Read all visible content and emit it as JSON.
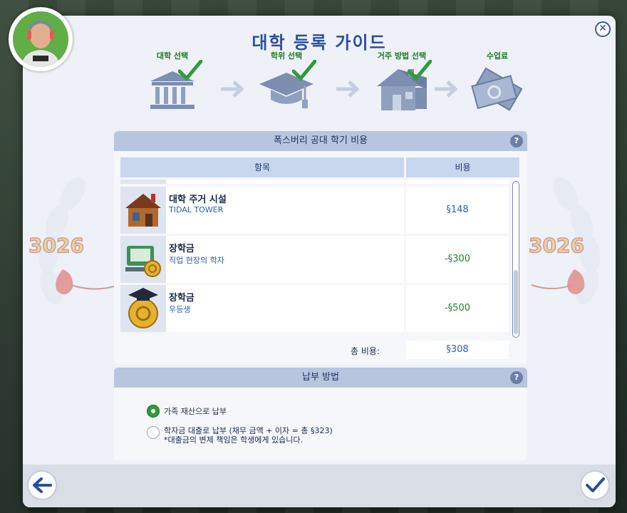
{
  "window": {
    "title": "대학 등록 가이드"
  },
  "steps": [
    {
      "label": "대학 선택",
      "done": true,
      "icon": "university-building-icon"
    },
    {
      "label": "학위 선택",
      "done": true,
      "icon": "graduation-cap-icon"
    },
    {
      "label": "거주 방법 선택",
      "done": true,
      "icon": "house-icon"
    },
    {
      "label": "수업료",
      "done": false,
      "icon": "money-bills-icon"
    }
  ],
  "cost_panel": {
    "title": "폭스버리 공대 학기 비용",
    "col_item": "항목",
    "col_cost": "비용",
    "rows": [
      {
        "name": "대학 주거 시설",
        "sub": "TIDAL TOWER",
        "cost": "§148",
        "cost_type": "charge",
        "icon": "house-icon"
      },
      {
        "name": "장학금",
        "sub": "직업 현장의 학자",
        "cost": "-§300",
        "cost_type": "credit",
        "icon": "computer-coin-icon"
      },
      {
        "name": "장학금",
        "sub": "우등생",
        "cost": "-§500",
        "cost_type": "credit",
        "icon": "gold-coin-cap-icon"
      }
    ],
    "total_label": "총 비용:",
    "total_value": "§308"
  },
  "pay_panel": {
    "title": "납부 방법",
    "options": [
      {
        "label": "가족 재산으로 납부",
        "note": "",
        "selected": true
      },
      {
        "label": "학자금 대출로 납부 (채무 금액 + 이자 = 총 §323)",
        "note": "*대출금의 변제 책임은 학생에게 있습니다.",
        "selected": false
      }
    ]
  },
  "colors": {
    "accent": "#2a4f9e",
    "check": "#2f9b3a",
    "credit": "#1f8a2a",
    "charge": "#2a60b8"
  }
}
